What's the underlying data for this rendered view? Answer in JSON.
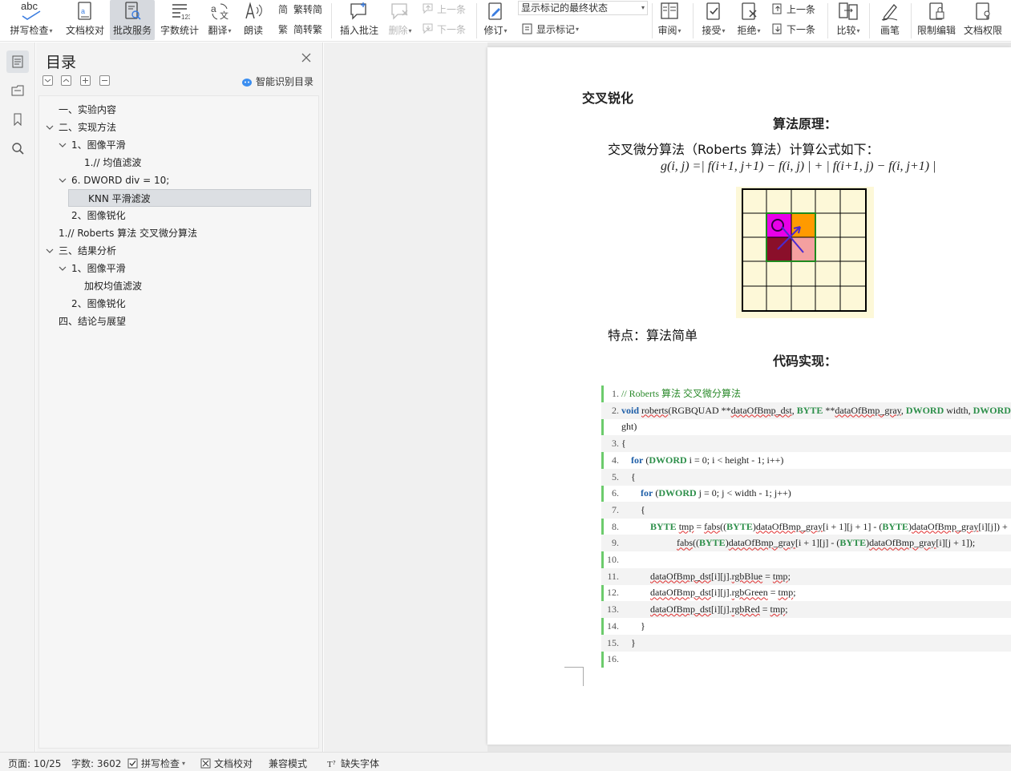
{
  "ribbon": {
    "spell_check": "拼写检查",
    "doc_check": "文档校对",
    "revise_service": "批改服务",
    "word_count": "字数统计",
    "translate": "翻译",
    "read_aloud": "朗读",
    "trad_convert": "繁转简",
    "simp_convert": "简转繁",
    "insert_comment": "插入批注",
    "delete": "删除",
    "prev_comment": "上一条",
    "next_comment": "下一条",
    "track_changes": "修订",
    "markup_state": "显示标记的最终状态",
    "show_markup": "显示标记",
    "review": "审阅",
    "accept": "接受",
    "reject": "拒绝",
    "prev_change": "上一条",
    "next_change": "下一条",
    "compare": "比较",
    "pen": "画笔",
    "restrict_edit": "限制编辑",
    "doc_permission": "文档权限",
    "abc": "abc"
  },
  "toc": {
    "title": "目录",
    "smart_toc": "智能识别目录",
    "items": [
      {
        "label": "一、实验内容",
        "level": 0,
        "expanded": null
      },
      {
        "label": "二、实现方法",
        "level": 0,
        "expanded": true
      },
      {
        "label": "1、图像平滑",
        "level": 1,
        "expanded": true
      },
      {
        "label": "1.// 均值滤波",
        "level": 2,
        "expanded": null
      },
      {
        "label": "6.   DWORD div = 10;",
        "level": 1,
        "expanded": true
      },
      {
        "label": "KNN 平滑滤波",
        "level": 2,
        "expanded": null,
        "selected": true
      },
      {
        "label": "2、图像锐化",
        "level": 1,
        "expanded": null
      },
      {
        "label": "1.// Roberts 算法 交叉微分算法",
        "level": 0,
        "expanded": null
      },
      {
        "label": "三、结果分析",
        "level": 0,
        "expanded": true
      },
      {
        "label": "1、图像平滑",
        "level": 1,
        "expanded": true
      },
      {
        "label": "加权均值滤波",
        "level": 2,
        "expanded": null
      },
      {
        "label": "2、图像锐化",
        "level": 1,
        "expanded": null
      },
      {
        "label": "四、结论与展望",
        "level": 0,
        "expanded": null
      }
    ]
  },
  "doc": {
    "heading_sharpen": "交叉锐化",
    "heading_principle": "算法原理：",
    "intro": "交叉微分算法（Roberts 算法）计算公式如下：",
    "formula": "g(i, j) =| f(i+1, j+1) − f(i, j) | + | f(i+1, j) − f(i, j+1) |",
    "feature": "特点：算法简单",
    "heading_code": "代码实现：",
    "code_lines": [
      {
        "n": "1.",
        "t": "// Roberts 算法 交叉微分算法"
      },
      {
        "n": "2.",
        "t": "void roberts(RGBQUAD **dataOfBmp_dst, BYTE **dataOfBmp_gray, DWORD width, DWORD"
      },
      {
        "n": "",
        "t": "ght)"
      },
      {
        "n": "3.",
        "t": "{"
      },
      {
        "n": "4.",
        "t": "for (DWORD i = 0; i < height - 1; i++)"
      },
      {
        "n": "5.",
        "t": "{"
      },
      {
        "n": "6.",
        "t": "for (DWORD j = 0; j < width - 1; j++)"
      },
      {
        "n": "7.",
        "t": "{"
      },
      {
        "n": "8.",
        "t": "BYTE tmp = fabs((BYTE)dataOfBmp_gray[i + 1][j + 1] - (BYTE)dataOfBmp_gray[i][j]) +"
      },
      {
        "n": "9.",
        "t": "fabs((BYTE)dataOfBmp_gray[i + 1][j] - (BYTE)dataOfBmp_gray[i][j + 1]);"
      },
      {
        "n": "10.",
        "t": ""
      },
      {
        "n": "11.",
        "t": "dataOfBmp_dst[i][j].rgbBlue = tmp;"
      },
      {
        "n": "12.",
        "t": "dataOfBmp_dst[i][j].rgbGreen = tmp;"
      },
      {
        "n": "13.",
        "t": "dataOfBmp_dst[i][j].rgbRed = tmp;"
      },
      {
        "n": "14.",
        "t": "}"
      },
      {
        "n": "15.",
        "t": "}"
      },
      {
        "n": "16.",
        "t": ""
      }
    ]
  },
  "status": {
    "page": "页面: 10/25",
    "words": "字数: 3602",
    "spell": "拼写检查",
    "proof": "文档校对",
    "compat": "兼容模式",
    "missing_font": "缺失字体"
  },
  "colors": {
    "accent_green": "#6ccb6c",
    "selected_bg": "#dcdfe3",
    "magenta": "#e800e8",
    "orange": "#ff9a00",
    "dark_red": "#8a0f2a",
    "pink": "#f4a0a0",
    "arrow": "#4a2ad0"
  }
}
